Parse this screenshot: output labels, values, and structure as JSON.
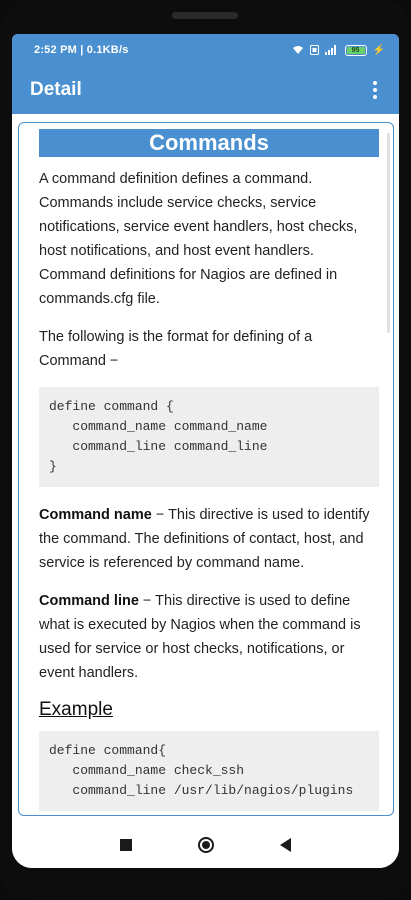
{
  "status": {
    "time": "2:52 PM | 0.1KB/s",
    "battery": "95"
  },
  "appbar": {
    "title": "Detail",
    "more_icon": "more-vert-icon"
  },
  "article": {
    "heading": "Commands",
    "intro": "A command definition defines a command. Commands include service checks, service notifications, service event handlers, host checks, host notifications, and host event handlers. Command definitions for Nagios are defined in commands.cfg file.",
    "format_text": "The following is the format for defining of a Command −",
    "code_format": "define command {\n   command_name command_name\n   command_line command_line\n}",
    "command_name_label": "Command name",
    "command_name_desc": " − This directive is used to identify the command. The definitions of contact, host, and service is referenced by command name.",
    "command_line_label": "Command line",
    "command_line_desc": " − This directive is used to define what is executed by Nagios when the command is used for service or host checks, notifications, or event handlers.",
    "example_heading": "Example",
    "code_example": "define command{\n   command_name check_ssh\n   command_line /usr/lib/nagios/plugins"
  },
  "nav": {
    "recents": "square-icon",
    "home": "circle-icon",
    "back": "back-triangle-icon"
  },
  "colors": {
    "accent": "#4a8fd0"
  }
}
